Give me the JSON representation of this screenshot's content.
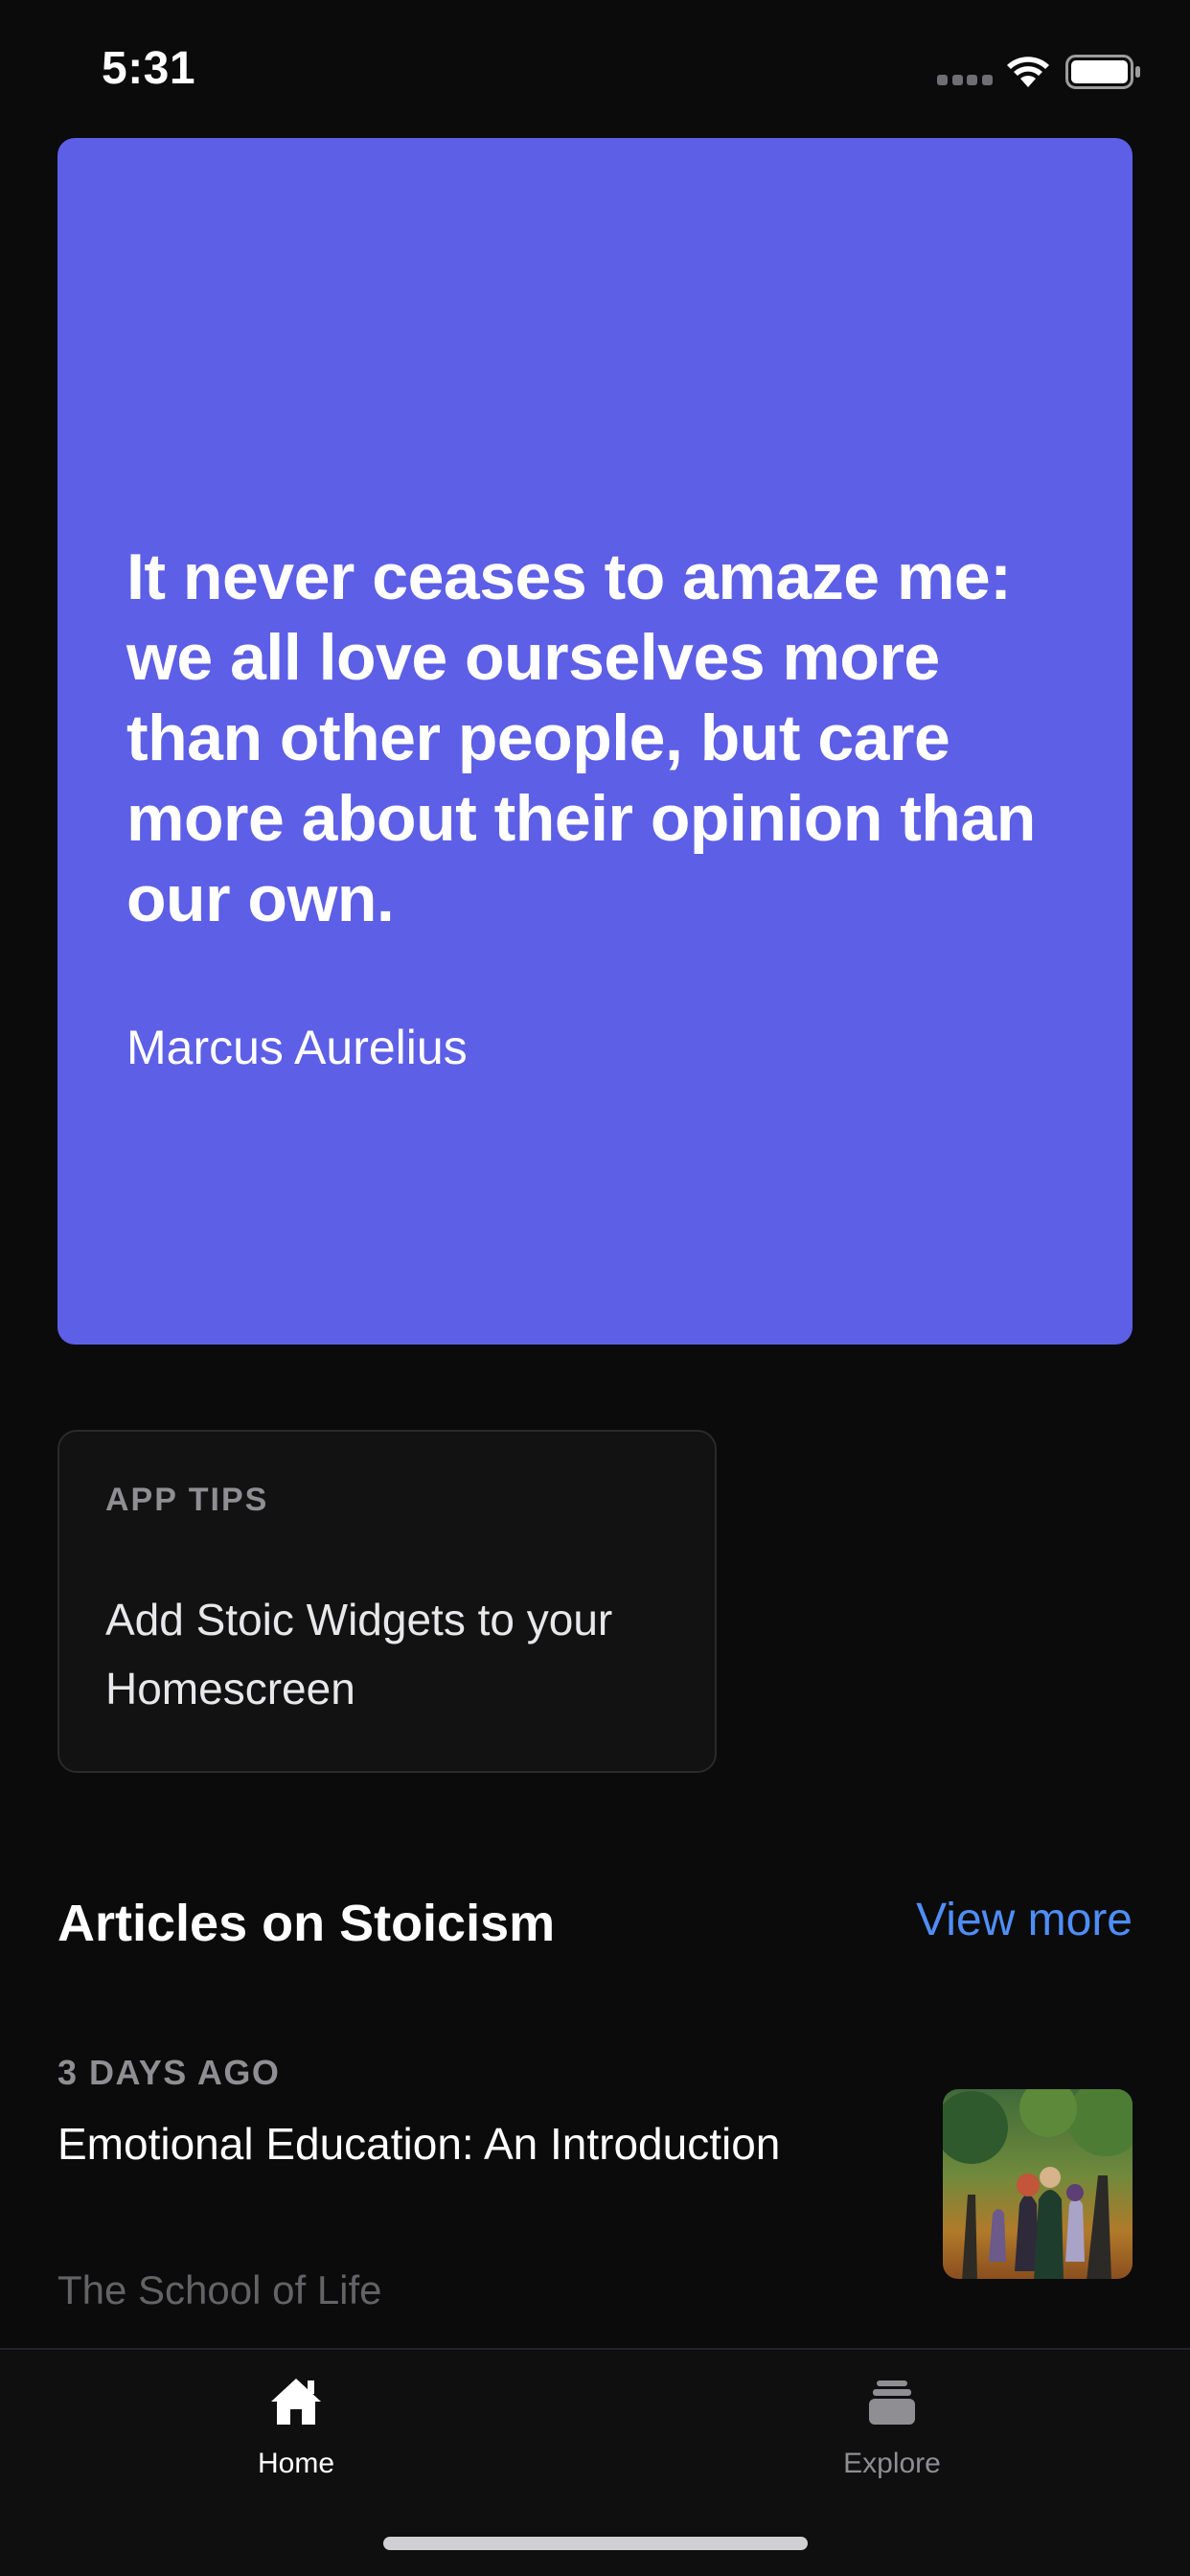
{
  "status_bar": {
    "time": "5:31",
    "icons": [
      "signal-icon",
      "wifi-icon",
      "battery-icon"
    ]
  },
  "quote": {
    "text": "It never ceases to amaze me: we all love ourselves more than other people, but care more about their opinion than our own.",
    "author": "Marcus Aurelius",
    "background_color": "#5d5fe6"
  },
  "app_tips": {
    "label": "APP TIPS",
    "text": "Add Stoic Widgets to your Homescreen"
  },
  "articles": {
    "title": "Articles on Stoicism",
    "view_more_label": "View more",
    "accent_color": "#4f8ef7",
    "items": [
      {
        "date": "3 DAYS AGO",
        "title": "Emotional Education: An Introduction",
        "source": "The School of Life",
        "thumbnail_icon": "painting-thumbnail"
      }
    ]
  },
  "tab_bar": {
    "tabs": [
      {
        "label": "Home",
        "icon": "home-icon",
        "active": true
      },
      {
        "label": "Explore",
        "icon": "stack-icon",
        "active": false
      }
    ]
  }
}
